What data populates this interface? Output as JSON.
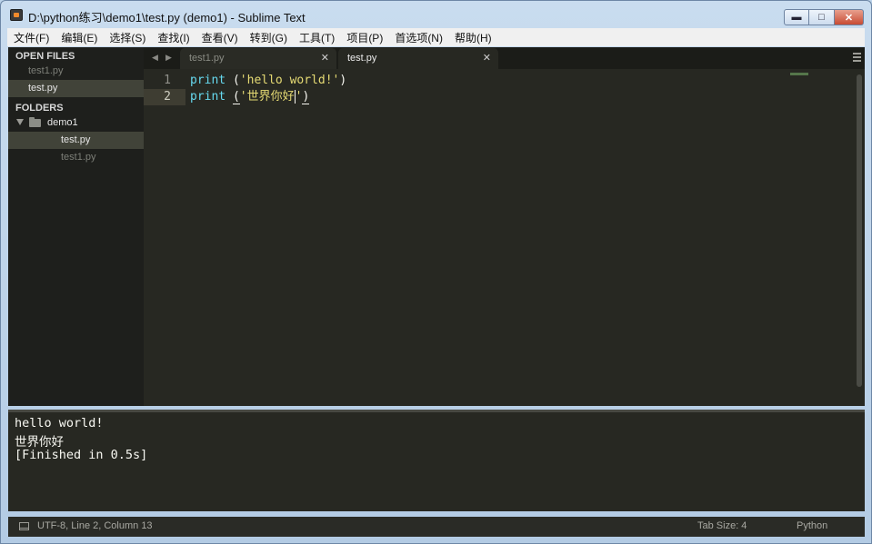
{
  "window": {
    "title": "D:\\python练习\\demo1\\test.py (demo1) - Sublime Text",
    "minimize_glyph": "▬",
    "maximize_glyph": "□",
    "close_glyph": "✕"
  },
  "menu": [
    "文件(F)",
    "编辑(E)",
    "选择(S)",
    "查找(I)",
    "查看(V)",
    "转到(G)",
    "工具(T)",
    "项目(P)",
    "首选项(N)",
    "帮助(H)"
  ],
  "sidebar": {
    "open_files_heading": "OPEN FILES",
    "open_files": [
      "test1.py",
      "test.py"
    ],
    "folders_heading": "FOLDERS",
    "folder_name": "demo1",
    "folder_files": [
      "test.py",
      "test1.py"
    ]
  },
  "tabs": {
    "prev_glyph": "◀",
    "next_glyph": "▶",
    "items": [
      {
        "label": "test1.py",
        "close": "✕"
      },
      {
        "label": "test.py",
        "close": "✕"
      }
    ]
  },
  "editor": {
    "line_numbers": [
      "1",
      "2"
    ],
    "line1": {
      "kw": "print",
      "sp": " (",
      "str": "'hello world!'",
      "end": ")"
    },
    "line2": {
      "kw": "print",
      "sp": " ",
      "open": "(",
      "str_a": "'世界你好",
      "str_b": "'",
      "close": ")"
    }
  },
  "output": {
    "lines": [
      "hello world!",
      "世界你好",
      "[Finished in 0.5s]"
    ]
  },
  "status": {
    "position": "UTF-8, Line 2, Column 13",
    "tab_size": "Tab Size: 4",
    "syntax": "Python"
  },
  "colors": {
    "editor_bg": "#272822",
    "keyword": "#66d9ef",
    "string": "#e6db74",
    "text": "#f8f8f2"
  }
}
